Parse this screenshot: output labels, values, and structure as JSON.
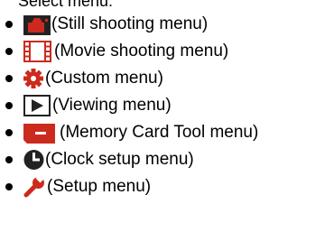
{
  "top_fragment": "Select menu:",
  "menu_items": [
    {
      "icon": "camera-icon",
      "label": "(Still shooting menu)"
    },
    {
      "icon": "film-icon",
      "label": "(Movie shooting menu)"
    },
    {
      "icon": "gear-icon",
      "label": "(Custom menu)"
    },
    {
      "icon": "play-icon",
      "label": "(Viewing menu)"
    },
    {
      "icon": "memory-card-icon",
      "label": "(Memory Card Tool menu)"
    },
    {
      "icon": "clock-icon",
      "label": "(Clock setup menu)"
    },
    {
      "icon": "wrench-icon",
      "label": "(Setup menu)"
    }
  ],
  "colors": {
    "icon_dark": "#222222",
    "icon_red": "#cc2a1e",
    "text": "#000000"
  }
}
